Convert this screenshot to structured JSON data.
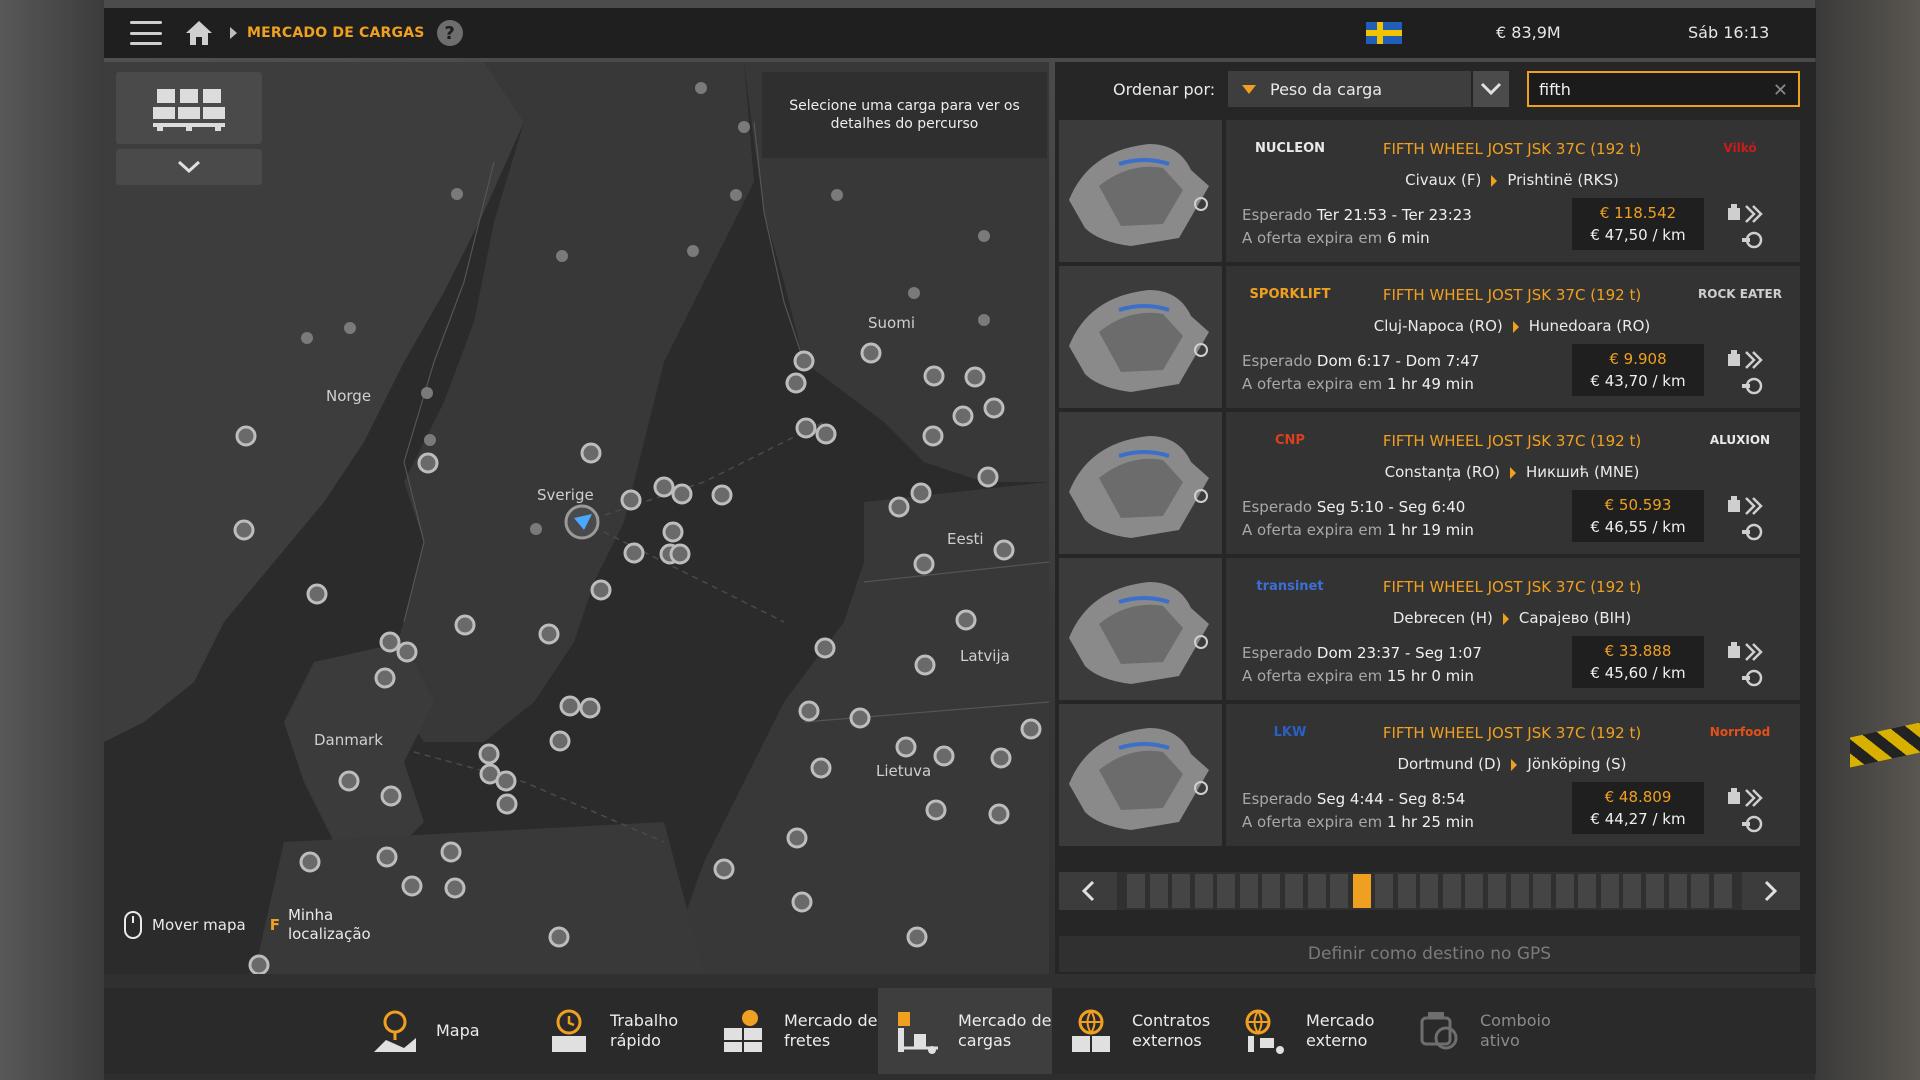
{
  "topbar": {
    "breadcrumb": "MERCADO DE CARGAS",
    "help": "?",
    "money": "€ 83,9M",
    "time": "Sáb 16:13"
  },
  "map": {
    "hint": "Selecione uma carga para ver os detalhes do percurso",
    "labels": {
      "norge": "Norge",
      "sverige": "Sverige",
      "suomi": "Suomi",
      "eesti": "Eesti",
      "latvija": "Latvija",
      "danmark": "Danmark",
      "lietuva": "Lietuva"
    },
    "footer": {
      "move": "Mover mapa",
      "key": "F",
      "location": "Minha\nlocalização"
    }
  },
  "sort": {
    "label": "Ordenar por:",
    "value": "Peso da carga"
  },
  "search": {
    "value": "fifth"
  },
  "jobs": [
    {
      "logo_left": "NUCLEON",
      "logo_right": "Vilkó",
      "title": "FIFTH WHEEL JOST JSK 37C (192 t)",
      "from": "Civaux (F)",
      "to": "Prishtinë (RKS)",
      "expected_label": "Esperado",
      "expected": "Ter 21:53 - Ter 23:23",
      "expires_label": "A oferta expira em",
      "expires": "6 min",
      "price": "€ 118.542",
      "per_km": "€ 47,50 / km"
    },
    {
      "logo_left": "SPORKLIFT",
      "logo_right": "ROCK EATER",
      "title": "FIFTH WHEEL JOST JSK 37C (192 t)",
      "from": "Cluj-Napoca (RO)",
      "to": "Hunedoara (RO)",
      "expected_label": "Esperado",
      "expected": "Dom 6:17 - Dom 7:47",
      "expires_label": "A oferta expira em",
      "expires": "1 hr 49 min",
      "price": "€ 9.908",
      "per_km": "€ 43,70 / km"
    },
    {
      "logo_left": "CNP",
      "logo_right": "ALUXION",
      "title": "FIFTH WHEEL JOST JSK 37C (192 t)",
      "from": "Constanța (RO)",
      "to": "Никшић (MNE)",
      "expected_label": "Esperado",
      "expected": "Seg 5:10 - Seg 6:40",
      "expires_label": "A oferta expira em",
      "expires": "1 hr 19 min",
      "price": "€ 50.593",
      "per_km": "€ 46,55 / km"
    },
    {
      "logo_left": "transinet",
      "logo_right": "",
      "title": "FIFTH WHEEL JOST JSK 37C (192 t)",
      "from": "Debrecen (H)",
      "to": "Сарајево (BIH)",
      "expected_label": "Esperado",
      "expected": "Dom 23:37 - Seg 1:07",
      "expires_label": "A oferta expira em",
      "expires": "15 hr 0 min",
      "price": "€ 33.888",
      "per_km": "€ 45,60 / km"
    },
    {
      "logo_left": "LKW",
      "logo_right": "Norrfood",
      "title": "FIFTH WHEEL JOST JSK 37C (192 t)",
      "from": "Dortmund (D)",
      "to": "Jönköping (S)",
      "expected_label": "Esperado",
      "expected": "Seg 4:44 - Seg 8:54",
      "expires_label": "A oferta expira em",
      "expires": "1 hr 25 min",
      "price": "€ 48.809",
      "per_km": "€ 44,27 / km"
    }
  ],
  "pager": {
    "total_pages": 27,
    "active_page": 11
  },
  "gps_button": "Definir como destino no GPS",
  "nav": [
    {
      "label": "Mapa",
      "icon": "map-icon"
    },
    {
      "label": "Trabalho\nrápido",
      "icon": "quick-job-icon"
    },
    {
      "label": "Mercado de\nfretes",
      "icon": "freight-market-icon"
    },
    {
      "label": "Mercado de\ncargas",
      "icon": "cargo-market-icon"
    },
    {
      "label": "Contratos\nexternos",
      "icon": "external-contracts-icon"
    },
    {
      "label": "Mercado\nexterno",
      "icon": "external-market-icon"
    },
    {
      "label": "Comboio\nativo",
      "icon": "convoy-icon"
    }
  ],
  "colors": {
    "accent": "#f0a020",
    "panel": "#262626",
    "active_nav": "#3e3e3e"
  }
}
